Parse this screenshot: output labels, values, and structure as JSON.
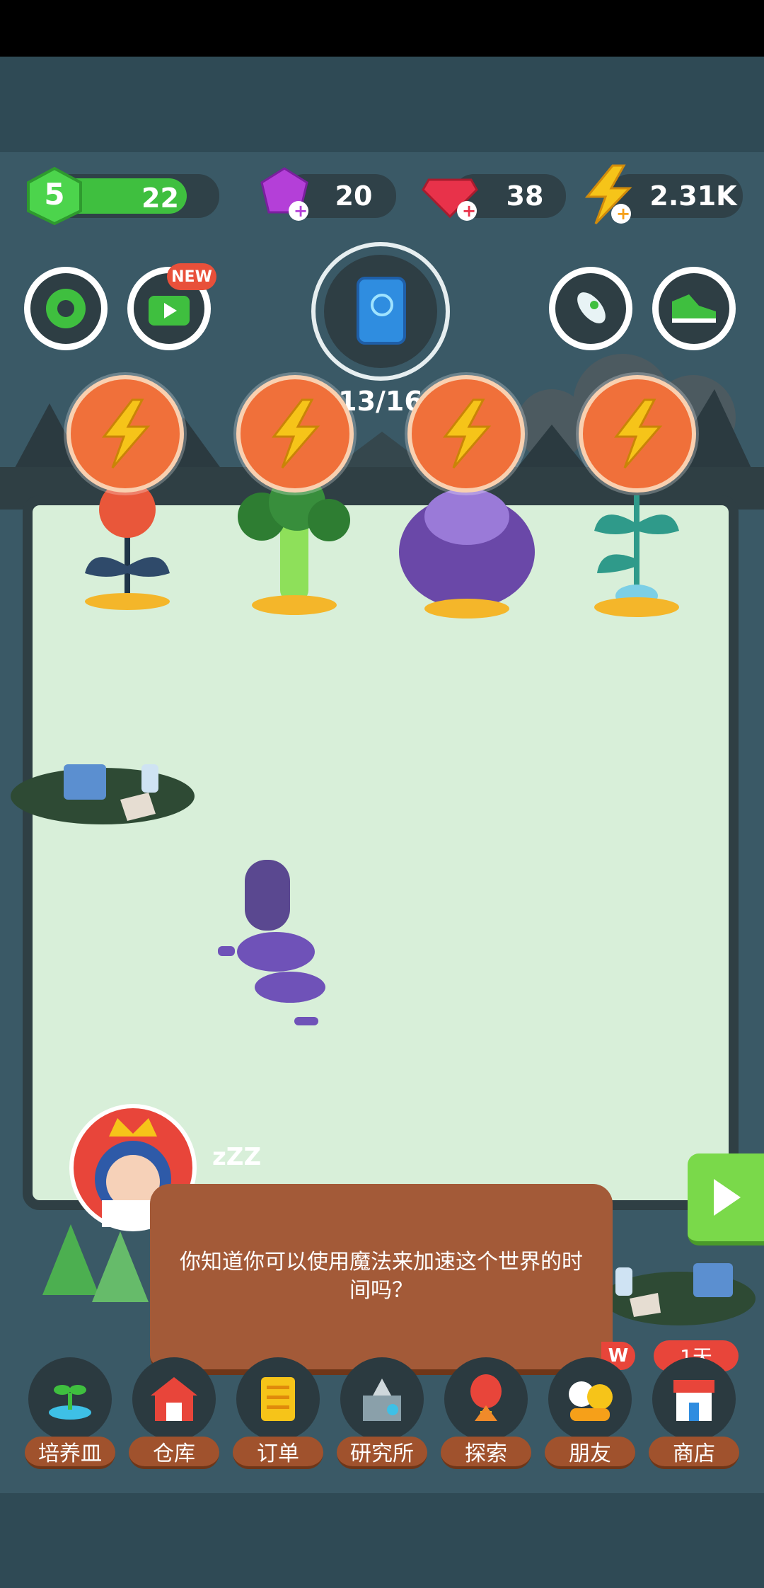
{
  "hud": {
    "level": "5",
    "xp": "22",
    "gems_purple": "20",
    "gems_red": "38",
    "energy": "2.31K"
  },
  "top_buttons": {
    "new_badge": "NEW"
  },
  "book": {
    "progress_text": "13/16"
  },
  "garden": {
    "plants": [
      {
        "name": "red-flower-plant",
        "color": "#e9573a"
      },
      {
        "name": "broccoli-plant",
        "color": "#4caf50"
      },
      {
        "name": "purple-cabbage-plant",
        "color": "#6a48a8"
      },
      {
        "name": "sprout-plant",
        "color": "#2f9a8a"
      }
    ]
  },
  "sleep_text": "zZZ",
  "dialog": {
    "message": "你知道你可以使用魔法来加速这个世界的时间吗？"
  },
  "badges": {
    "left_partial": "W",
    "shop_timer": "1天"
  },
  "nav": {
    "items": [
      {
        "label": "培养皿",
        "icon": "sprout-icon"
      },
      {
        "label": "仓库",
        "icon": "barn-icon"
      },
      {
        "label": "订单",
        "icon": "scroll-icon"
      },
      {
        "label": "研究所",
        "icon": "lab-icon"
      },
      {
        "label": "探索",
        "icon": "balloon-icon"
      },
      {
        "label": "朋友",
        "icon": "friends-icon"
      },
      {
        "label": "商店",
        "icon": "shop-icon"
      }
    ]
  },
  "colors": {
    "accent_green": "#3fbf3f",
    "bolt_orange": "#f0703a",
    "nav_brown": "#a0522d",
    "play_green": "#7ad94a"
  }
}
